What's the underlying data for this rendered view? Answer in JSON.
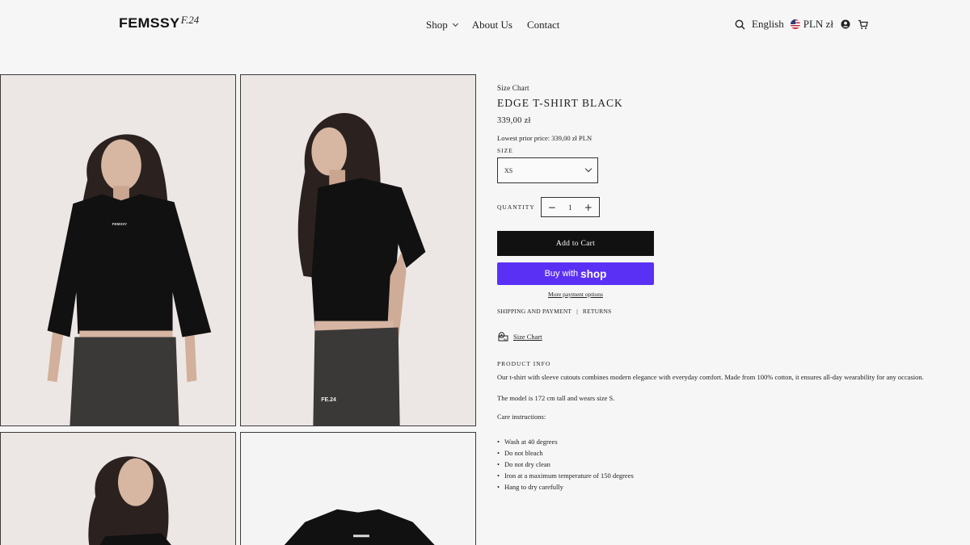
{
  "header": {
    "logo_main": "FEMSSY",
    "logo_sup": "F.24",
    "nav": [
      {
        "label": "Shop"
      },
      {
        "label": "About Us"
      },
      {
        "label": "Contact"
      }
    ],
    "language": "English",
    "currency": "PLN zł"
  },
  "product": {
    "size_chart_top": "Size Chart",
    "title": "EDGE T-SHIRT BLACK",
    "price": "339,00 zł",
    "lowest_price": "Lowest prior price: 339,00 zł PLN",
    "size_label": "SIZE",
    "size_value": "XS",
    "quantity_label": "QUANTITY",
    "quantity_value": "1",
    "add_to_cart": "Add to Cart",
    "buy_with": "Buy with",
    "shop_brand": "shop",
    "more_payment": "More payment options",
    "shipping_link": "SHIPPING AND PAYMENT",
    "separator": "|",
    "returns_link": "RETURNS",
    "size_chart_link": "Size Chart",
    "info_label": "PRODUCT INFO",
    "description": "Our t-shirt with sleeve cutouts combines modern elegance with everyday comfort. Made from 100% cotton, it ensures all-day wearability for any occasion.",
    "model_note": "The model is 172 cm tall and wears size S.",
    "care_label": "Care instructions:",
    "care": [
      "Wash at 40 degrees",
      "Do not bleach",
      "Do not dry clean",
      "Iron at a maximum temperature of 150 degrees",
      "Hang to dry carefully"
    ]
  },
  "gallery": {
    "shirt_print": "FE.24"
  },
  "colors": {
    "shop_pay": "#5a31f4",
    "cart_button": "#111111"
  }
}
